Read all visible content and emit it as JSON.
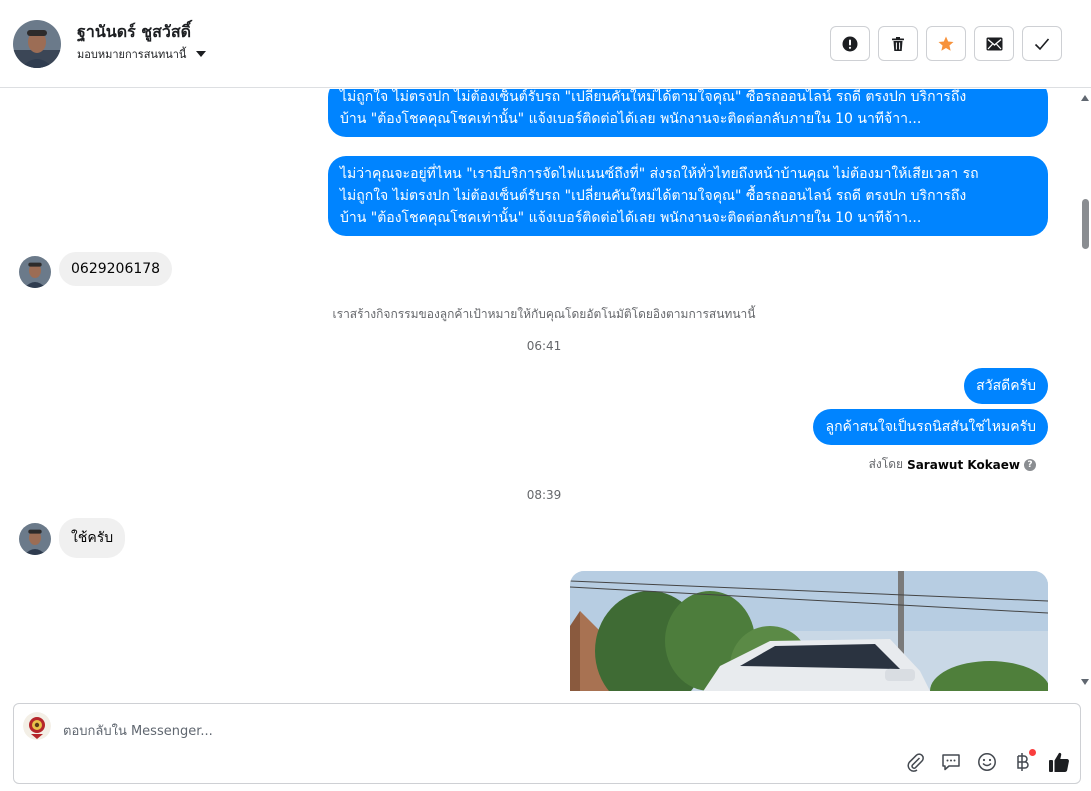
{
  "header": {
    "contact_name": "ฐานันดร์ ชูสวัสดิ์",
    "assign_label": "มอบหมายการสนทนานี้",
    "actions": [
      {
        "name": "mark-spam",
        "icon": "exclamation-circle-icon"
      },
      {
        "name": "delete",
        "icon": "trash-icon"
      },
      {
        "name": "star",
        "icon": "star-icon",
        "color": "#f7923b"
      },
      {
        "name": "mark-unread",
        "icon": "envelope-icon"
      },
      {
        "name": "mark-done",
        "icon": "check-icon"
      }
    ]
  },
  "messages": {
    "out_1": {
      "line1": "ไม่ถูกใจ ไม่ตรงปก ไม่ต้องเซ็นต์รับรถ \"เปลี่ยนคันใหม่ได้ตามใจคุณ\" ซื้อรถออนไลน์ รถดี ตรงปก บริการถึง",
      "line2": "บ้าน \"ต้องโชคคุณโชคเท่านั้น\" แจ้งเบอร์ติดต่อได้เลย พนักงานจะติดต่อกลับภายใน 10 นาทีจ้าา..."
    },
    "out_2": {
      "line1": "ไม่ว่าคุณจะอยู่ที่ไหน \"เรามีบริการจัดไฟแนนซ์ถึงที่\"  ส่งรถให้ทั่วไทยถึงหน้าบ้านคุณ ไม่ต้องมาให้เสียเวลา รถ",
      "line2": "ไม่ถูกใจ ไม่ตรงปก ไม่ต้องเซ็นต์รับรถ \"เปลี่ยนคันใหม่ได้ตามใจคุณ\" ซื้อรถออนไลน์ รถดี ตรงปก บริการถึง",
      "line3": "บ้าน \"ต้องโชคคุณโชคเท่านั้น\" แจ้งเบอร์ติดต่อได้เลย พนักงานจะติดต่อกลับภายใน 10 นาทีจ้าา..."
    },
    "in_phone": "0629206178",
    "system_note": "เราสร้างกิจกรรมของลูกค้าเป้าหมายให้กับคุณโดยอัตโนมัติโดยอิงตามการสนทนานี้",
    "time_1": "06:41",
    "out_greeting": "สวัสดีครับ",
    "out_question": "ลูกค้าสนใจเป็นรถนิสสันใช่ไหมครับ",
    "sent_by_prefix": "ส่งโดย",
    "sent_by_name": "Sarawut Kokaew",
    "time_2": "08:39",
    "in_reply": "ใช้ครับ"
  },
  "composer": {
    "placeholder": "ตอบกลับใน Messenger...",
    "tools": [
      "paperclip-icon",
      "chat-bubble-icon",
      "smiley-icon",
      "baht-icon",
      "thumbs-up-icon"
    ]
  },
  "colors": {
    "accent": "#0084ff",
    "incoming_bubble": "#f0f0f0",
    "star": "#f7923b"
  }
}
